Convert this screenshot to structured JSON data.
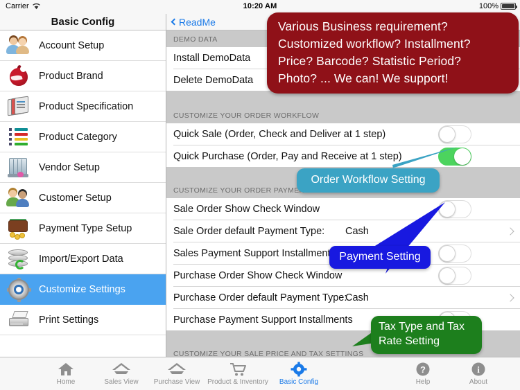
{
  "statusbar": {
    "carrier": "Carrier",
    "wifi_icon": "wifi-icon",
    "time": "10:20 AM",
    "battery_percent": "100%",
    "battery_icon": "battery-icon"
  },
  "sidebar": {
    "title": "Basic Config",
    "items": [
      {
        "label": "Account Setup",
        "icon": "people-icon",
        "selected": false
      },
      {
        "label": "Product Brand",
        "icon": "apple-icon",
        "selected": false
      },
      {
        "label": "Product Specification",
        "icon": "documents-icon",
        "selected": false
      },
      {
        "label": "Product Category",
        "icon": "list-icon",
        "selected": false
      },
      {
        "label": "Vendor Setup",
        "icon": "warehouse-icon",
        "selected": false
      },
      {
        "label": "Customer Setup",
        "icon": "customers-icon",
        "selected": false
      },
      {
        "label": "Payment Type Setup",
        "icon": "wallet-icon",
        "selected": false
      },
      {
        "label": "Import/Export Data",
        "icon": "database-sync-icon",
        "selected": false
      },
      {
        "label": "Customize Settings",
        "icon": "gear-icon",
        "selected": true
      },
      {
        "label": "Print Settings",
        "icon": "printer-icon",
        "selected": false
      }
    ]
  },
  "navbar": {
    "back_label": "ReadMe",
    "back_icon": "chevron-left-icon"
  },
  "sections": [
    {
      "header": "DEMO DATA",
      "rows": [
        {
          "label": "Install DemoData",
          "type": "disclosure",
          "accessory": "chevron-right-icon"
        },
        {
          "label": "Delete DemoData",
          "type": "disclosure",
          "accessory": "chevron-right-icon"
        }
      ]
    },
    {
      "header": "CUSTOMIZE YOUR ORDER WORKFLOW",
      "rows": [
        {
          "label": "Quick Sale (Order, Check and Deliver at 1 step)",
          "type": "switch",
          "value": "off"
        },
        {
          "label": "Quick Purchase (Order, Pay and Receive at 1 step)",
          "type": "switch",
          "value": "on"
        }
      ]
    },
    {
      "header": "CUSTOMIZE YOUR ORDER PAYMENT",
      "rows": [
        {
          "label": "Sale Order Show Check Window",
          "type": "switch",
          "value": "off"
        },
        {
          "label": "Sale Order default Payment Type:",
          "type": "value",
          "value": "Cash",
          "accessory": "chevron-right-icon"
        },
        {
          "label": "Sales Payment Support Installments",
          "type": "switch",
          "value": "off"
        },
        {
          "label": "Purchase Order Show Check Window",
          "type": "switch",
          "value": "off"
        },
        {
          "label": "Purchase Order default Payment Type:",
          "type": "value",
          "value": "Cash",
          "accessory": "chevron-right-icon"
        },
        {
          "label": "Purchase Payment Support Installments",
          "type": "switch",
          "value": "off"
        }
      ]
    },
    {
      "header": "CUSTOMIZE YOUR SALE PRICE AND TAX SETTINGS",
      "rows": []
    }
  ],
  "callouts": [
    {
      "id": "red",
      "color": "#8f1118",
      "lines": [
        "Various Business requirement?",
        "Customized  workflow?  Installment?",
        "Price?  Barcode?  Statistic  Period?",
        "Photo? ...         We can! We support!"
      ]
    },
    {
      "id": "order-workflow",
      "color": "#3ba3c4",
      "lines": [
        "Order Workflow Setting"
      ]
    },
    {
      "id": "payment",
      "color": "#1819e0",
      "lines": [
        "Payment Setting"
      ]
    },
    {
      "id": "tax",
      "color": "#1d7f1d",
      "lines": [
        "Tax Type and Tax",
        "Rate Setting"
      ]
    }
  ],
  "tabbar": {
    "items": [
      {
        "label": "Home",
        "icon": "home-icon",
        "active": false
      },
      {
        "label": "Sales View",
        "icon": "sales-house-icon",
        "active": false
      },
      {
        "label": "Purchase View",
        "icon": "purchase-house-icon",
        "active": false
      },
      {
        "label": "Product & Inventory",
        "icon": "cart-icon",
        "active": false
      },
      {
        "label": "Basic Config",
        "icon": "gear-icon",
        "active": true
      },
      {
        "label": "Help",
        "icon": "question-icon",
        "active": false
      },
      {
        "label": "About",
        "icon": "info-icon",
        "active": false
      }
    ]
  }
}
